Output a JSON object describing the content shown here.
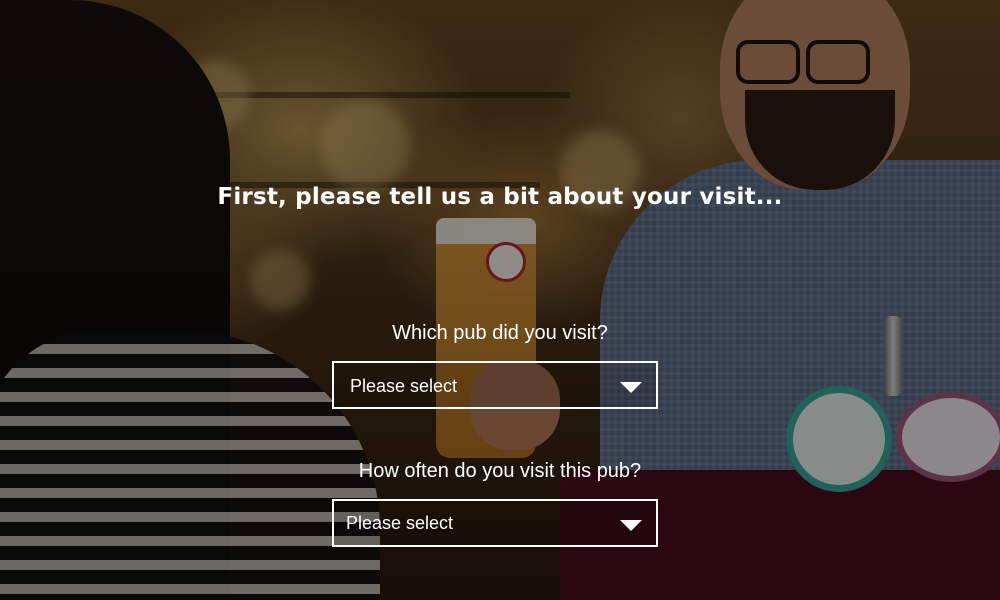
{
  "form": {
    "heading": "First, please tell us a bit about your visit...",
    "questions": [
      {
        "label": "Which pub did you visit?",
        "selected": "Please select"
      },
      {
        "label": "How often do you visit this pub?",
        "selected": "Please select"
      }
    ]
  },
  "icons": {
    "dropdown": "chevron-down-icon"
  },
  "colors": {
    "text": "#ffffff",
    "field_border": "#ffffff",
    "overlay": "rgba(0,0,0,0.42)"
  }
}
